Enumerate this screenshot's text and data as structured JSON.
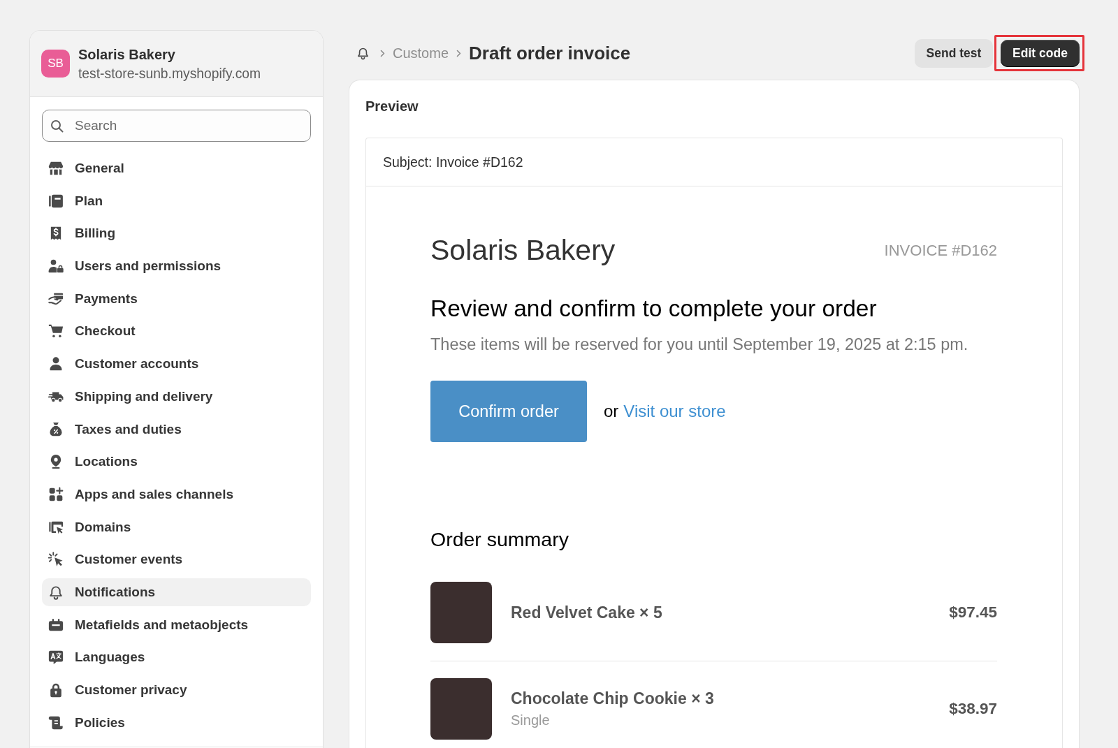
{
  "sidebar": {
    "store": {
      "initials": "SB",
      "name": "Solaris Bakery",
      "domain": "test-store-sunb.myshopify.com"
    },
    "search": {
      "placeholder": "Search"
    },
    "items": [
      {
        "label": "General",
        "selected": false
      },
      {
        "label": "Plan",
        "selected": false
      },
      {
        "label": "Billing",
        "selected": false
      },
      {
        "label": "Users and permissions",
        "selected": false
      },
      {
        "label": "Payments",
        "selected": false
      },
      {
        "label": "Checkout",
        "selected": false
      },
      {
        "label": "Customer accounts",
        "selected": false
      },
      {
        "label": "Shipping and delivery",
        "selected": false
      },
      {
        "label": "Taxes and duties",
        "selected": false
      },
      {
        "label": "Locations",
        "selected": false
      },
      {
        "label": "Apps and sales channels",
        "selected": false
      },
      {
        "label": "Domains",
        "selected": false
      },
      {
        "label": "Customer events",
        "selected": false
      },
      {
        "label": "Notifications",
        "selected": true
      },
      {
        "label": "Metafields and metaobjects",
        "selected": false
      },
      {
        "label": "Languages",
        "selected": false
      },
      {
        "label": "Customer privacy",
        "selected": false
      },
      {
        "label": "Policies",
        "selected": false
      }
    ]
  },
  "header": {
    "breadcrumb": {
      "parent": "Custome",
      "title": "Draft order invoice"
    },
    "buttons": [
      {
        "label": "Send test",
        "kind": "secondary",
        "highlighted": false
      },
      {
        "label": "Edit code",
        "kind": "primary",
        "highlighted": true
      }
    ]
  },
  "preview": {
    "title": "Preview",
    "subject": "Subject: Invoice #D162",
    "email": {
      "shop_name": "Solaris Bakery",
      "invoice_number": "INVOICE #D162",
      "heading": "Review and confirm to complete your order",
      "message": "These items will be reserved for you until September 19, 2025 at 2:15 pm.",
      "button": "Confirm order",
      "alt_text": "or",
      "link": "Visit our store",
      "summary_title": "Order summary",
      "items": [
        {
          "name": "Red Velvet Cake × 5",
          "price": "$97.45"
        },
        {
          "name": "Chocolate Chip Cookie × 3",
          "variant": "Single",
          "price": "$38.97"
        }
      ]
    }
  }
}
